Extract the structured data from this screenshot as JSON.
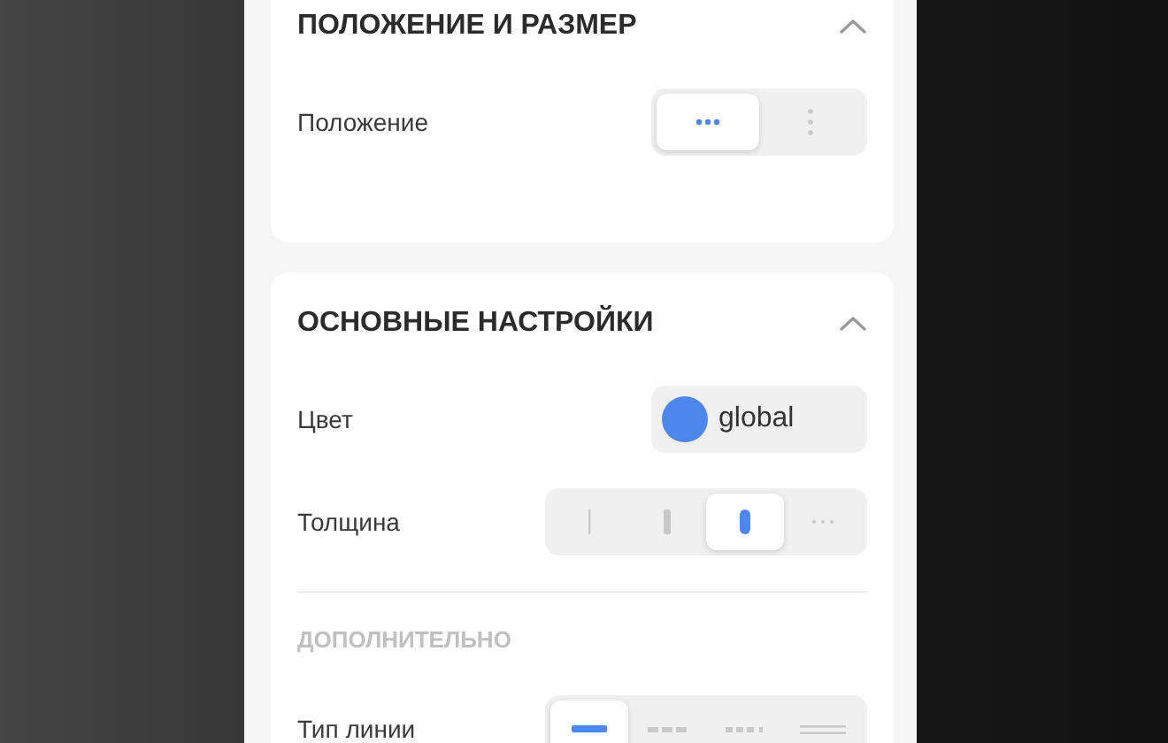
{
  "sections": [
    {
      "title": "ПОЛОЖЕНИЕ И РАЗМЕР",
      "expanded": true,
      "rows": [
        {
          "kind": "segmented",
          "label": "Положение",
          "options": [
            {
              "kind": "dots-horizontal",
              "selected": true
            },
            {
              "kind": "dots-vertical",
              "selected": false
            }
          ]
        }
      ]
    },
    {
      "title": "ОСНОВНЫЕ НАСТРОЙКИ",
      "expanded": true,
      "rows": [
        {
          "kind": "color",
          "label": "Цвет",
          "color": "#4f86ee",
          "value": "global"
        },
        {
          "kind": "segmented",
          "label": "Толщина",
          "options": [
            {
              "kind": "thin",
              "selected": false
            },
            {
              "kind": "medium",
              "selected": false
            },
            {
              "kind": "thick",
              "selected": true
            },
            {
              "kind": "more",
              "selected": false
            }
          ]
        },
        {
          "kind": "divider"
        },
        {
          "kind": "subheading",
          "label": "ДОПОЛНИТЕЛЬНО"
        },
        {
          "kind": "segmented",
          "label": "Тип линии",
          "options": [
            {
              "kind": "solid",
              "selected": true
            },
            {
              "kind": "dashed",
              "selected": false
            },
            {
              "kind": "dotted",
              "selected": false
            },
            {
              "kind": "double",
              "selected": false
            }
          ]
        }
      ]
    }
  ]
}
